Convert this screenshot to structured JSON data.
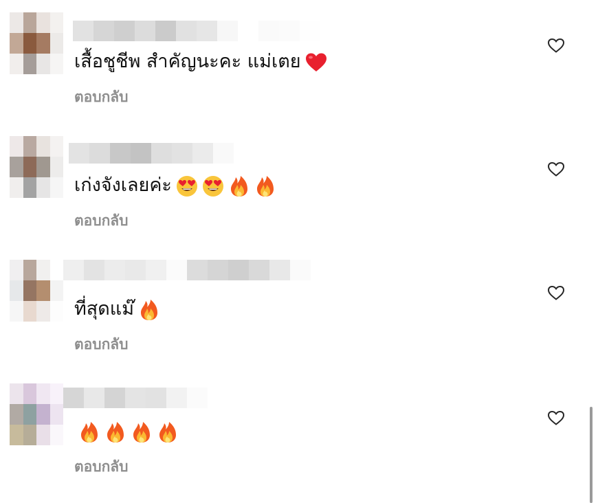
{
  "comments": [
    {
      "text": "เสื้อชูชีพ สำคัญนะคะ แม่เตย",
      "emojis": [
        "heart"
      ],
      "reply_label": "ตอบกลับ",
      "avatar_colors": [
        "#ece8e6",
        "#b9a69a",
        "#e9e2de",
        "#f3f1ef",
        "#c2a896",
        "#8a5a3e",
        "#a57b62",
        "#eceae8",
        "#f1eeec",
        "#a59d99",
        "#e8e6e5",
        "#f6f5f4"
      ],
      "name_colors": [
        "#e2e2e2",
        "#d6d6d6",
        "#cfcfcf",
        "#dcdcdc",
        "#cbcbcb",
        "#e1e1e1",
        "#e6e6e6",
        "#f7f7f7",
        "#ffffff",
        "#fafafa",
        "#fbfbfb",
        "#fefefe"
      ]
    },
    {
      "text": "เก่งจังเลยค่ะ",
      "emojis": [
        "heart-eyes",
        "heart-eyes",
        "fire",
        "fire"
      ],
      "reply_label": "ตอบกลับ",
      "avatar_colors": [
        "#eee8e8",
        "#b9a9a1",
        "#e8e3df",
        "#f4f2f1",
        "#a8a19c",
        "#8d6a58",
        "#a09890",
        "#edeceb",
        "#f0eeed",
        "#a3a3a3",
        "#e6e5e5",
        "#f6f6f6"
      ],
      "name_colors": [
        "#e3e3e3",
        "#dcdcdc",
        "#c8c8c8",
        "#c3c3c3",
        "#dedede",
        "#e2e2e2",
        "#ebebeb",
        "#f9f9f9",
        "#ffffff"
      ]
    },
    {
      "text": "ที่สุดแม๊",
      "emojis": [
        "fire"
      ],
      "reply_label": "ตอบกลับ",
      "avatar_colors": [
        "#f0eff0",
        "#b8a79c",
        "#f1f0ef",
        "#ffffff",
        "#e6e8ea",
        "#957562",
        "#b48e6f",
        "#f3f3f3",
        "#f6f6f6",
        "#e8d9cf",
        "#eeeae8",
        "#fdfdfd"
      ],
      "name_colors": [
        "#efefef",
        "#e3e3e3",
        "#ececec",
        "#e9e9e9",
        "#f0f0f0",
        "#fbfbfb",
        "#dcdcdc",
        "#d5d5d5",
        "#cfcfcf",
        "#d9d9d9",
        "#e8e8e8",
        "#fafafa"
      ]
    },
    {
      "text": "",
      "emojis": [
        "fire",
        "fire",
        "fire",
        "fire"
      ],
      "reply_label": "ตอบกลับ",
      "avatar_colors": [
        "#ece4ec",
        "#d9c7dc",
        "#f0e7f2",
        "#f8f2fa",
        "#b1aaa4",
        "#8ea1a1",
        "#c4b2cf",
        "#ede4f0",
        "#c7bb9c",
        "#b6ad98",
        "#e9dfe8",
        "#faf7fb"
      ],
      "name_colors": [
        "#d6d6d6",
        "#e8e8e8",
        "#d4d4d4",
        "#e4e4e4",
        "#e2e2e2",
        "#f2f2f2",
        "#fbfbfb"
      ]
    }
  ]
}
